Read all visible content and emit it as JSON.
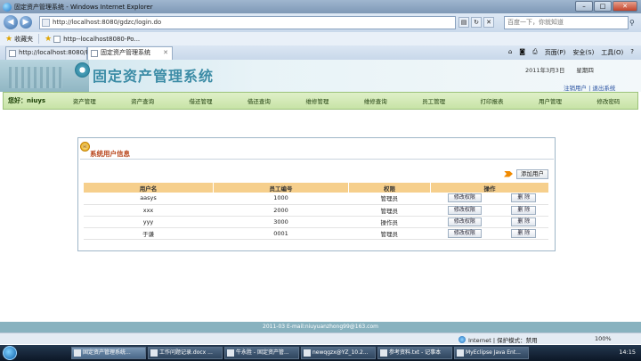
{
  "window": {
    "title": "固定资产管理系统 - Windows Internet Explorer",
    "buttons": [
      "–",
      "□",
      "✕"
    ]
  },
  "address": {
    "url": "http://localhost:8080/gdzc/login.do",
    "search_placeholder": "百度一下，你就知道"
  },
  "favorites": {
    "label": "收藏夹",
    "item": "http--localhost8080-Po..."
  },
  "tabs": [
    {
      "label": "http://localhost:8080/Po..."
    },
    {
      "label": "固定资产管理系统"
    }
  ],
  "commandbar": [
    "页面(P)",
    "安全(S)",
    "工具(O)",
    "?"
  ],
  "banner": {
    "system_title": "固定资产管理系统",
    "date": "2011年3月3日　　星期四",
    "links": "注销用户 | 退出系统"
  },
  "menu": {
    "greeting": "您好：niuys",
    "items": [
      "资产管理",
      "资产查询",
      "借还管理",
      "借还查询",
      "维修管理",
      "维修查询",
      "员工管理",
      "打印报表",
      "用户管理",
      "修改密码"
    ]
  },
  "panel": {
    "title": "系统用户信息",
    "icon_text": "HI",
    "add_user_label": "添加用户",
    "table": {
      "headers": [
        "用户名",
        "员工编号",
        "权限",
        "操作"
      ],
      "modify_label": "修改权限",
      "delete_label": "删 除",
      "rows": [
        {
          "username": "aasys",
          "emp_no": "1000",
          "role": "管理员"
        },
        {
          "username": "xxx",
          "emp_no": "2000",
          "role": "管理员"
        },
        {
          "username": "yyy",
          "emp_no": "3000",
          "role": "操作员"
        },
        {
          "username": "于谦",
          "emp_no": "0001",
          "role": "管理员"
        }
      ]
    }
  },
  "footer": {
    "text": "2011-03 E-mail:niuyuanzhong99@163.com"
  },
  "statusbar": {
    "zone": "Internet | 保护模式：禁用",
    "zoom": "100%"
  },
  "taskbar": {
    "tasks": [
      "固定资产管理系统...",
      "工作问题记录.docx ...",
      "牛永胜 - 固定资产管...",
      "newqgzx@YZ_10.2...",
      "参考资料.txt - 记事本",
      "MyEclipse Java Ent..."
    ],
    "clock": "14:15"
  }
}
